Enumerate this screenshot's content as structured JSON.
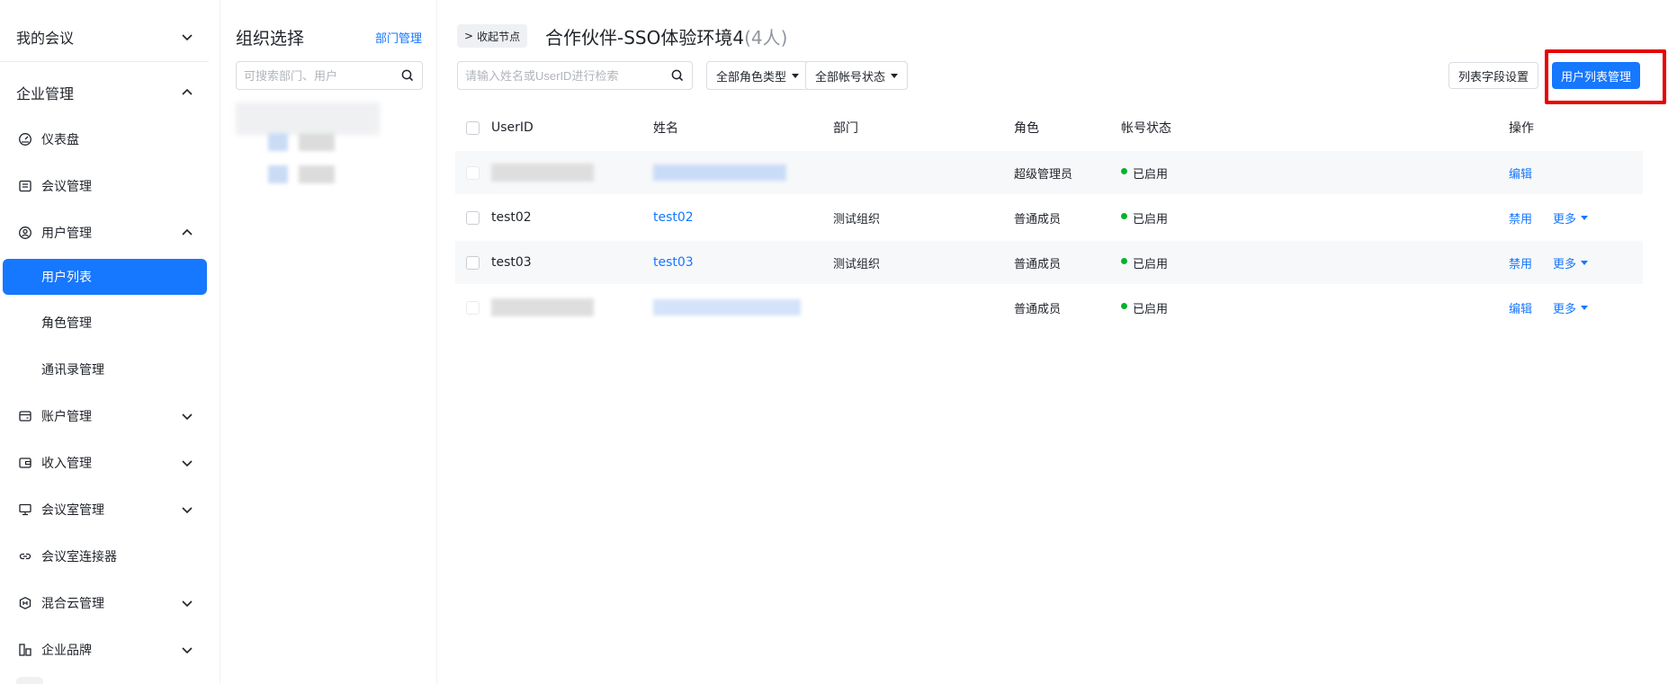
{
  "sidebar": {
    "my_meetings": "我的会议",
    "enterprise_mgmt": "企业管理",
    "items": [
      {
        "label": "仪表盘",
        "icon": "dashboard-icon"
      },
      {
        "label": "会议管理",
        "icon": "meeting-list-icon"
      },
      {
        "label": "用户管理",
        "icon": "user-icon"
      },
      {
        "label": "用户列表"
      },
      {
        "label": "角色管理"
      },
      {
        "label": "通讯录管理"
      },
      {
        "label": "账户管理",
        "icon": "wallet-icon"
      },
      {
        "label": "收入管理",
        "icon": "income-icon"
      },
      {
        "label": "会议室管理",
        "icon": "room-icon"
      },
      {
        "label": "会议室连接器",
        "icon": "link-icon"
      },
      {
        "label": "混合云管理",
        "icon": "cloud-icon"
      },
      {
        "label": "企业品牌",
        "icon": "brand-icon"
      }
    ]
  },
  "org": {
    "title": "组织选择",
    "manage_link": "部门管理",
    "search_placeholder": "可搜索部门、用户"
  },
  "main": {
    "collapse_label": "收起节点",
    "title": "合作伙伴-SSO体验环境4",
    "count": "(4人)",
    "search_placeholder": "请输入姓名或UserID进行检索",
    "role_filter": "全部角色类型",
    "status_filter": "全部帐号状态",
    "column_settings": "列表字段设置",
    "user_list_mgmt": "用户列表管理"
  },
  "table": {
    "headers": {
      "userid": "UserID",
      "name": "姓名",
      "dept": "部门",
      "role": "角色",
      "status": "帐号状态",
      "actions": "操作"
    },
    "rows": [
      {
        "userid": "",
        "name": "",
        "dept": "",
        "role": "超级管理员",
        "status": "已启用",
        "action1": "编辑",
        "action2": ""
      },
      {
        "userid": "test02",
        "name": "test02",
        "dept": "测试组织",
        "role": "普通成员",
        "status": "已启用",
        "action1": "禁用",
        "action2": "更多"
      },
      {
        "userid": "test03",
        "name": "test03",
        "dept": "测试组织",
        "role": "普通成员",
        "status": "已启用",
        "action1": "禁用",
        "action2": "更多"
      },
      {
        "userid": "",
        "name": "",
        "dept": "",
        "role": "普通成员",
        "status": "已启用",
        "action1": "编辑",
        "action2": "更多"
      }
    ]
  },
  "colors": {
    "primary": "#1677ff",
    "enabled_dot": "#00b42a",
    "highlight": "#e60000"
  }
}
